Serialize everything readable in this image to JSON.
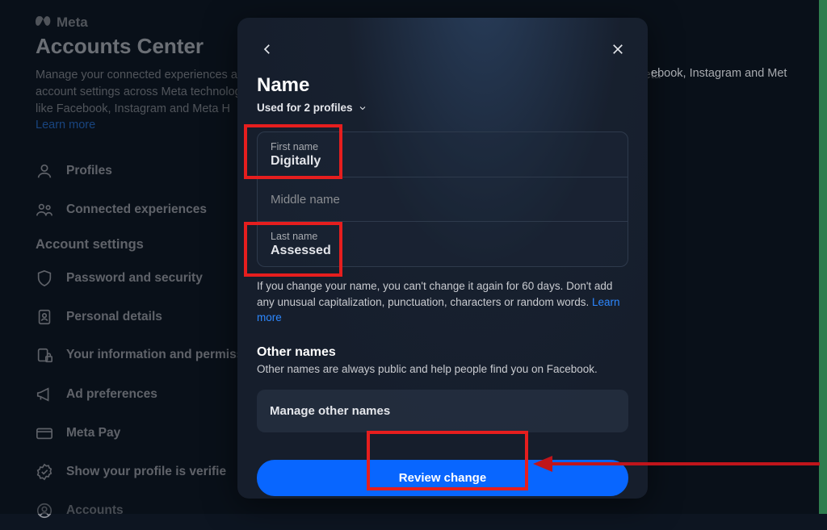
{
  "header": {
    "brand": "Meta",
    "title": "Accounts Center",
    "description_line1": "Manage your connected experiences and account settings across Meta technologies like Facebook, Instagram and Meta",
    "description_line2": "account settings across Meta technologies",
    "description_line3": "like Facebook, Instagram and Meta H",
    "learn_more": "Learn more",
    "visible_right_text": "ebook, Instagram and Met"
  },
  "nav": {
    "profiles": "Profiles",
    "connected_experiences": "Connected experiences",
    "account_settings_heading": "Account settings",
    "password_security": "Password and security",
    "personal_details": "Personal details",
    "your_info_permissions": "Your information and permissions",
    "ad_preferences": "Ad preferences",
    "meta_pay": "Meta Pay",
    "show_profile_verified": "Show your profile is verifie",
    "accounts": "Accounts"
  },
  "modal": {
    "title": "Name",
    "used_for": "Used for 2 profiles",
    "first_name_label": "First name",
    "first_name_value": "Digitally",
    "middle_name_placeholder": "Middle name",
    "last_name_label": "Last name",
    "last_name_value": "Assessed",
    "info_text": "If you change your name, you can't change it again for 60 days. Don't add any unusual capitalization, punctuation, characters or random words. ",
    "info_learn_more": "Learn more",
    "other_names_title": "Other names",
    "other_names_desc": "Other names are always public and help people find you on Facebook.",
    "manage_other_names": "Manage other names",
    "review_button": "Review change"
  },
  "annotations": {
    "highlight_firstname": true,
    "highlight_lastname": true,
    "highlight_review": true,
    "arrow_to_review": true
  }
}
